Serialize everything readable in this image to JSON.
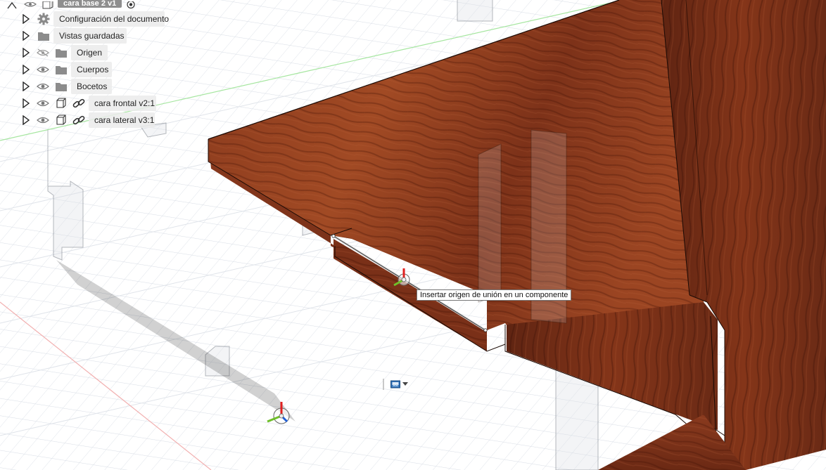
{
  "browser": {
    "root_label": "cara base 2 v1",
    "items": [
      {
        "label": "Configuración del documento",
        "icon": "gear-icon"
      },
      {
        "label": "Vistas guardadas",
        "icon": "folder-icon"
      },
      {
        "label": "Origen",
        "icon": "folder-icon",
        "visibility": "hidden-eye-icon"
      },
      {
        "label": "Cuerpos",
        "icon": "folder-icon",
        "visibility": "eye-icon"
      },
      {
        "label": "Bocetos",
        "icon": "folder-icon",
        "visibility": "eye-icon"
      },
      {
        "label": "cara frontal v2:1",
        "icon": "component-icon",
        "visibility": "eye-icon",
        "link": "link-icon"
      },
      {
        "label": "cara lateral v3:1",
        "icon": "component-icon",
        "visibility": "eye-icon",
        "link": "link-icon"
      }
    ]
  },
  "tooltip": {
    "text": "Insertar origen de unión en un componente"
  },
  "colors": {
    "wood_dark": "#6b2a16",
    "wood_mid": "#8e3b1f",
    "wood_light": "#a8552e",
    "grid": "#d5dbe3",
    "axis_green": "#9ee39a",
    "axis_red": "#f0a0a0"
  }
}
